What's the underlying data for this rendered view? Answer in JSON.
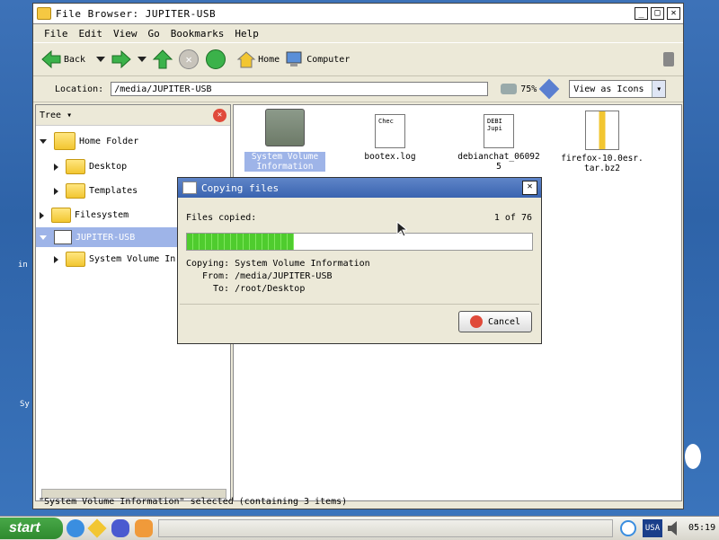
{
  "window": {
    "title": "File Browser: JUPITER-USB"
  },
  "menu": [
    "File",
    "Edit",
    "View",
    "Go",
    "Bookmarks",
    "Help"
  ],
  "toolbar": {
    "back": "Back",
    "home": "Home",
    "computer": "Computer"
  },
  "location": {
    "label": "Location:",
    "value": "/media/JUPITER-USB",
    "zoom": "75%",
    "view": "View as Icons"
  },
  "sidebar": {
    "header": "Tree",
    "items": [
      {
        "label": "Home Folder"
      },
      {
        "label": "Desktop"
      },
      {
        "label": "Templates"
      },
      {
        "label": "Filesystem"
      },
      {
        "label": "JUPITER-USB"
      },
      {
        "label": "System Volume In"
      }
    ]
  },
  "files": [
    {
      "name_l1": "System Volume",
      "name_l2": "Information"
    },
    {
      "name_l1": "bootex.log",
      "name_l2": "",
      "preview": "Chec"
    },
    {
      "name_l1": "debianchat_06092",
      "name_l2": "5",
      "preview": "DEBI Jupi"
    },
    {
      "name_l1": "firefox-10.0esr.",
      "name_l2": "tar.bz2"
    }
  ],
  "status": "\"System Volume Information\" selected (containing 3 items)",
  "dialog": {
    "title": "Copying files",
    "files_copied_label": "Files copied:",
    "count": "1 of 76",
    "progress": 0.31,
    "copying": "Copying: System Volume Information",
    "from": "From: /media/JUPITER-USB",
    "to": "To: /root/Desktop",
    "cancel": "Cancel"
  },
  "desktop_text": [
    "in",
    "Sy"
  ],
  "taskbar": {
    "start": "start",
    "lang": "USA",
    "time": "05:19"
  }
}
